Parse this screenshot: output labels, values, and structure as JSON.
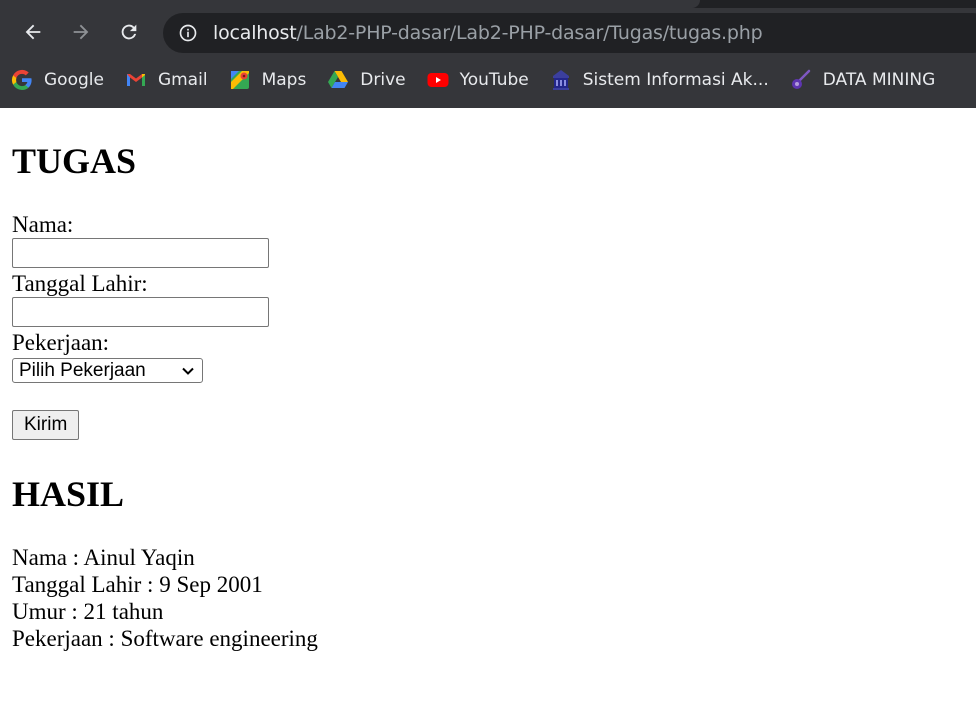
{
  "browser": {
    "address_bar": {
      "host": "localhost",
      "path": "/Lab2-PHP-dasar/Lab2-PHP-dasar/Tugas/tugas.php"
    },
    "bookmarks": [
      {
        "label": "Google",
        "icon": "google-icon"
      },
      {
        "label": "Gmail",
        "icon": "gmail-icon"
      },
      {
        "label": "Maps",
        "icon": "maps-icon"
      },
      {
        "label": "Drive",
        "icon": "drive-icon"
      },
      {
        "label": "YouTube",
        "icon": "youtube-icon"
      },
      {
        "label": "Sistem Informasi Ak...",
        "icon": "university-icon"
      },
      {
        "label": "DATA MINING",
        "icon": "data-mining-icon"
      }
    ]
  },
  "page": {
    "form_title": "TUGAS",
    "fields": {
      "nama_label": "Nama:",
      "nama_value": "",
      "tanggal_label": "Tanggal Lahir:",
      "tanggal_value": "",
      "pekerjaan_label": "Pekerjaan:",
      "pekerjaan_selected": "Pilih Pekerjaan"
    },
    "submit_label": "Kirim",
    "result_title": "HASIL",
    "results": {
      "nama": "Nama : Ainul Yaqin",
      "tanggal_lahir": "Tanggal Lahir : 9 Sep 2001",
      "umur": "Umur : 21 tahun",
      "pekerjaan": "Pekerjaan : Software engineering"
    }
  },
  "colors": {
    "chrome_bg": "#35363a",
    "omnibox_bg": "#202124",
    "url_host": "#e8eaed",
    "url_path": "#9aa0a6"
  }
}
